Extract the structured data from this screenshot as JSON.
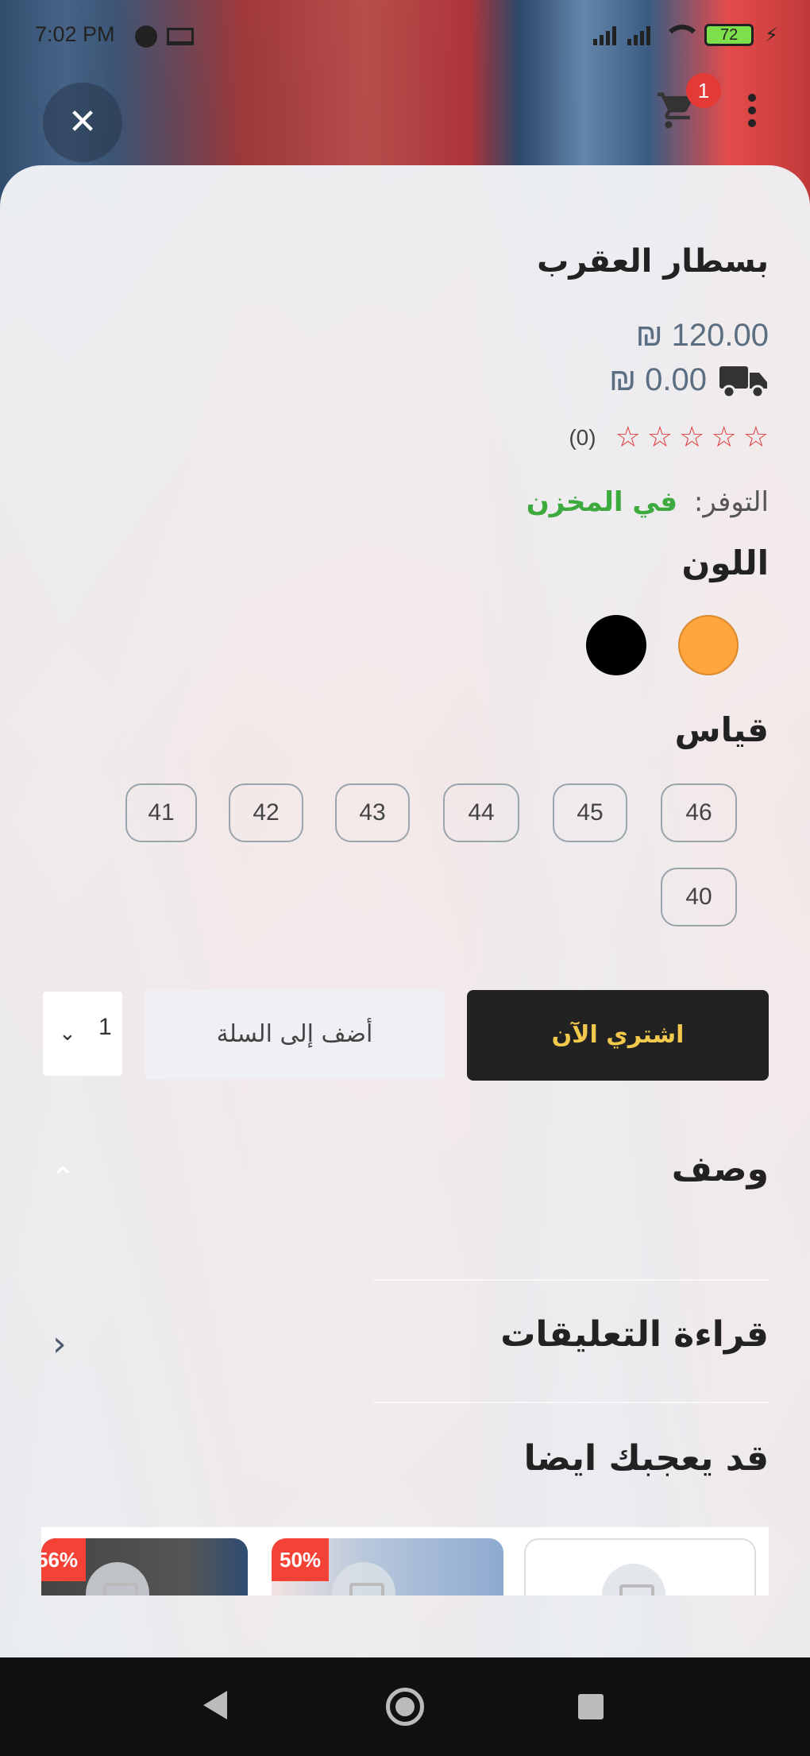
{
  "status_bar": {
    "time": "7:02 PM",
    "battery": "72"
  },
  "header": {
    "close_label": "✕",
    "cart_count": "1"
  },
  "product": {
    "title": "بسطار العقرب",
    "price": "₪ 120.00",
    "shipping_price": "₪ 0.00",
    "rating_count": "(0)",
    "stars": [
      "☆",
      "☆",
      "☆",
      "☆",
      "☆"
    ],
    "availability_label": "التوفر:",
    "availability_value": "في المخزن"
  },
  "colors": {
    "title": "اللون",
    "options": [
      {
        "name": "orange",
        "hex": "#ffa53d"
      },
      {
        "name": "black",
        "hex": "#000000"
      }
    ]
  },
  "sizes": {
    "title": "قياس",
    "options": [
      "46",
      "45",
      "44",
      "43",
      "42",
      "41",
      "40"
    ]
  },
  "purchase": {
    "quantity": "1",
    "add_to_cart": "أضف إلى السلة",
    "buy_now": "اشتري الآن"
  },
  "sections": {
    "description": "وصف",
    "reviews": "قراءة التعليقات",
    "related": "قد يعجبك ايضا"
  },
  "related_products": [
    {
      "discount": ""
    },
    {
      "discount": "50%"
    },
    {
      "discount": "56%"
    }
  ],
  "colors_theme": {
    "accent_red": "#e23b3b",
    "in_stock_green": "#3daa3d",
    "buy_button_bg": "#222222",
    "buy_button_text": "#f2c94c"
  }
}
